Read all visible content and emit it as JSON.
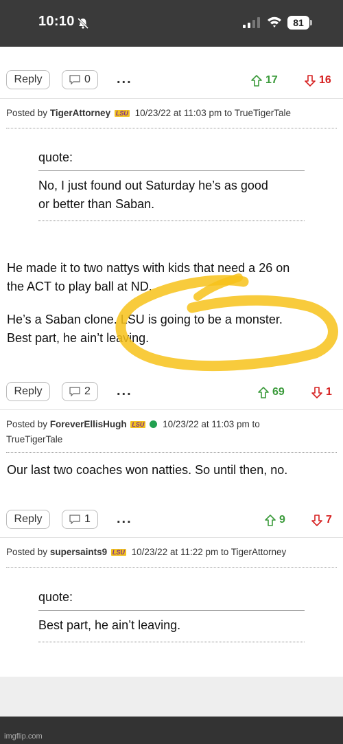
{
  "status_bar": {
    "time": "10:10",
    "battery": "81"
  },
  "actions": {
    "reply_label": "Reply",
    "more_label": "...",
    "rows": [
      {
        "comments": "0",
        "upvotes": "17",
        "downvotes": "16"
      },
      {
        "comments": "2",
        "upvotes": "69",
        "downvotes": "1"
      },
      {
        "comments": "1",
        "upvotes": "9",
        "downvotes": "7"
      }
    ]
  },
  "posts": [
    {
      "posted_by_label": "Posted by",
      "user": "TigerAttorney",
      "badge": "LSU",
      "timestamp": "10/23/22 at 11:03 pm to",
      "reply_to": "TrueTigerTale",
      "quote_label": "quote:",
      "quote_lines": [
        "No, I just found out Saturday he’s as good",
        "or better than Saban."
      ],
      "body_lines": [
        "He made it to two nattys with kids that need a 26 on",
        "the ACT to play ball at ND.",
        "He’s a Saban clone. LSU is going to be a monster.",
        "Best part, he ain’t leaving."
      ]
    },
    {
      "posted_by_label": "Posted by",
      "user": "ForeverEllisHugh",
      "badge": "LSU",
      "timestamp": "10/23/22 at 11:03 pm to",
      "reply_to": "TrueTigerTale",
      "body_lines": [
        "Our last two coaches won natties. So until then, no."
      ]
    },
    {
      "posted_by_label": "Posted by",
      "user": "supersaints9",
      "badge": "LSU",
      "timestamp": "10/23/22 at 11:22 pm to",
      "reply_to": "TigerAttorney",
      "quote_label": "quote:",
      "quote_lines": [
        "Best part, he ain’t leaving."
      ]
    }
  ],
  "watermark": "imgflip.com",
  "colors": {
    "upvote": "#3a9a3a",
    "downvote": "#d62020",
    "highlight": "#f7c21a",
    "lsu_purple": "#7a2b90",
    "lsu_gold": "#f0c020",
    "online": "#22a050"
  }
}
